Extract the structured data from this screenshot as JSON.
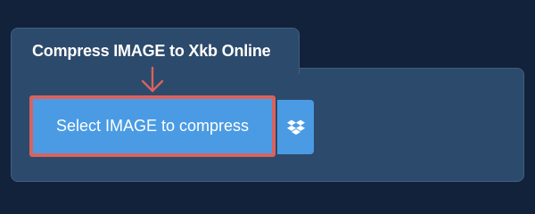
{
  "panel": {
    "title": "Compress IMAGE to Xkb Online"
  },
  "buttons": {
    "select_label": "Select IMAGE to compress",
    "dropbox_icon": "dropbox-icon"
  },
  "annotation": {
    "arrow_icon": "down-arrow-icon",
    "highlight_color": "#d8635e"
  },
  "colors": {
    "background": "#12223a",
    "panel": "#2c4a6c",
    "button": "#4a9be4",
    "highlight": "#d8635e"
  }
}
